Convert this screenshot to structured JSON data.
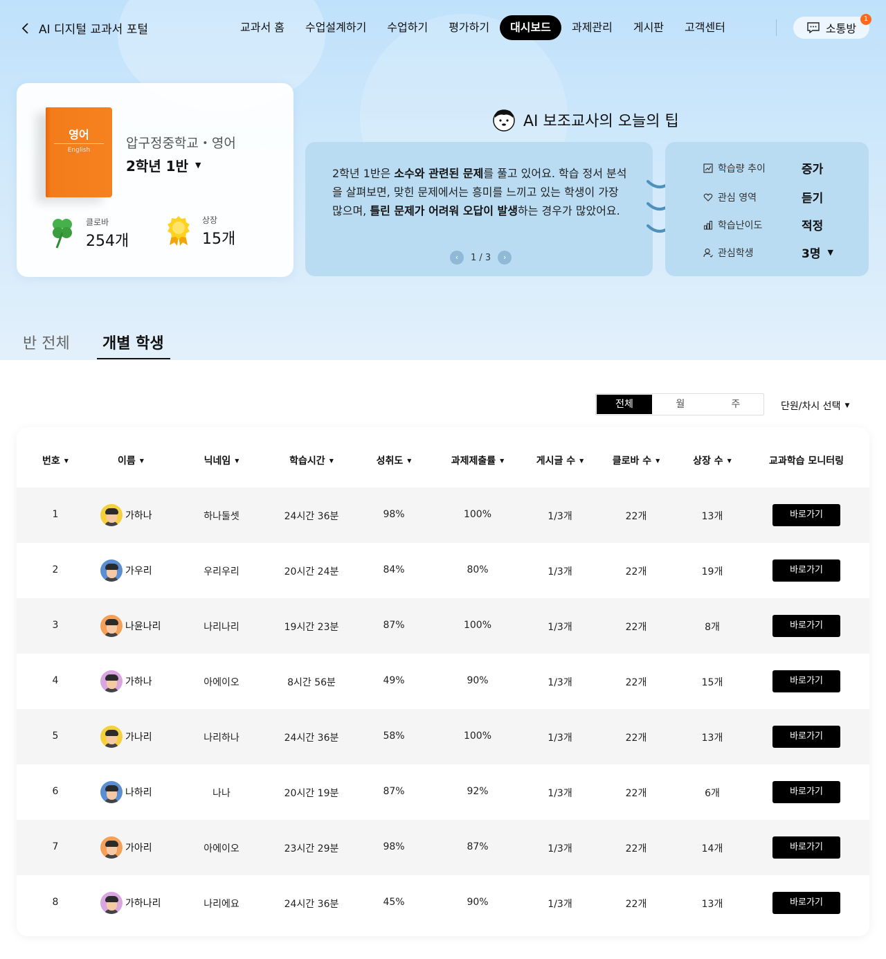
{
  "nav": {
    "back_label": "AI 디지털 교과서 포털",
    "menu": [
      {
        "label": "교과서 홈",
        "active": false
      },
      {
        "label": "수업설계하기",
        "active": false
      },
      {
        "label": "수업하기",
        "active": false
      },
      {
        "label": "평가하기",
        "active": false
      },
      {
        "label": "대시보드",
        "active": true
      },
      {
        "label": "과제관리",
        "active": false
      },
      {
        "label": "게시판",
        "active": false
      },
      {
        "label": "고객센터",
        "active": false
      }
    ],
    "chat_label": "소통방",
    "chat_badge": "1"
  },
  "book_card": {
    "book_title": "영어",
    "book_subtitle": "English",
    "school": "압구정중학교・영어",
    "class_name": "2학년 1반",
    "clover_label": "클로바",
    "clover_value": "254개",
    "award_label": "상장",
    "award_value": "15개"
  },
  "tip": {
    "title": "AI 보조교사의 오늘의 팁",
    "text_parts": [
      {
        "t": "2학년 1반은 ",
        "b": false
      },
      {
        "t": "소수와 관련된 문제",
        "b": true
      },
      {
        "t": "를 풀고 있어요. 학습 정서 분석을 살펴보면, 맞힌 문제에서는 흥미를 느끼고 있는 학생이 가장 많으며, ",
        "b": false
      },
      {
        "t": "틀린 문제가 어려워 오답이 발생",
        "b": true
      },
      {
        "t": "하는 경우가 많았어요.",
        "b": false
      }
    ],
    "pager": "1 / 3",
    "info": [
      {
        "icon": "trend-icon",
        "label": "학습량 추이",
        "value": "증가"
      },
      {
        "icon": "heart-icon",
        "label": "관심 영역",
        "value": "듣기"
      },
      {
        "icon": "bar-chart-icon",
        "label": "학습난이도",
        "value": "적정"
      },
      {
        "icon": "user-icon",
        "label": "관심학생",
        "value": "3명"
      }
    ]
  },
  "tabs": {
    "whole_class": "반 전체",
    "individual": "개별 학생"
  },
  "filters": {
    "segments": [
      {
        "label": "전체",
        "active": true
      },
      {
        "label": "월",
        "active": false
      },
      {
        "label": "주",
        "active": false
      }
    ],
    "unit_select": "단원/차시 선택"
  },
  "table": {
    "columns": [
      {
        "label": "번호",
        "sortable": true
      },
      {
        "label": "이름",
        "sortable": true
      },
      {
        "label": "닉네임",
        "sortable": true
      },
      {
        "label": "학습시간",
        "sortable": true
      },
      {
        "label": "성취도",
        "sortable": true
      },
      {
        "label": "과제제출률",
        "sortable": true
      },
      {
        "label": "게시글 수",
        "sortable": true
      },
      {
        "label": "클로바 수",
        "sortable": true
      },
      {
        "label": "상장 수",
        "sortable": true
      },
      {
        "label": "교과학습 모니터링",
        "sortable": false
      }
    ],
    "button_label": "바로가기",
    "rows": [
      {
        "no": "1",
        "name": "가하나",
        "nickname": "하나둘셋",
        "time": "24시간 36분",
        "achievement": "98%",
        "submission": "100%",
        "posts": "1/3개",
        "clover": "22개",
        "awards": "13개",
        "avatar_color": "#f4d03f"
      },
      {
        "no": "2",
        "name": "가우리",
        "nickname": "우리우리",
        "time": "20시간 24분",
        "achievement": "84%",
        "submission": "80%",
        "posts": "1/3개",
        "clover": "22개",
        "awards": "19개",
        "avatar_color": "#5b8fd1"
      },
      {
        "no": "3",
        "name": "나윤나리",
        "nickname": "나리나리",
        "time": "19시간 23분",
        "achievement": "87%",
        "submission": "100%",
        "posts": "1/3개",
        "clover": "22개",
        "awards": "8개",
        "avatar_color": "#f5a05a"
      },
      {
        "no": "4",
        "name": "가하나",
        "nickname": "아에이오",
        "time": "8시간 56분",
        "achievement": "49%",
        "submission": "90%",
        "posts": "1/3개",
        "clover": "22개",
        "awards": "15개",
        "avatar_color": "#d9a6e0"
      },
      {
        "no": "5",
        "name": "가나리",
        "nickname": "나리하나",
        "time": "24시간 36분",
        "achievement": "58%",
        "submission": "100%",
        "posts": "1/3개",
        "clover": "22개",
        "awards": "13개",
        "avatar_color": "#f4d03f"
      },
      {
        "no": "6",
        "name": "나하리",
        "nickname": "나나",
        "time": "20시간 19분",
        "achievement": "87%",
        "submission": "92%",
        "posts": "1/3개",
        "clover": "22개",
        "awards": "6개",
        "avatar_color": "#5b8fd1"
      },
      {
        "no": "7",
        "name": "가아리",
        "nickname": "아에이오",
        "time": "23시간 29분",
        "achievement": "98%",
        "submission": "87%",
        "posts": "1/3개",
        "clover": "22개",
        "awards": "14개",
        "avatar_color": "#f5a05a"
      },
      {
        "no": "8",
        "name": "가하나리",
        "nickname": "나리에요",
        "time": "24시간 36분",
        "achievement": "45%",
        "submission": "90%",
        "posts": "1/3개",
        "clover": "22개",
        "awards": "13개",
        "avatar_color": "#d9a6e0"
      }
    ]
  }
}
